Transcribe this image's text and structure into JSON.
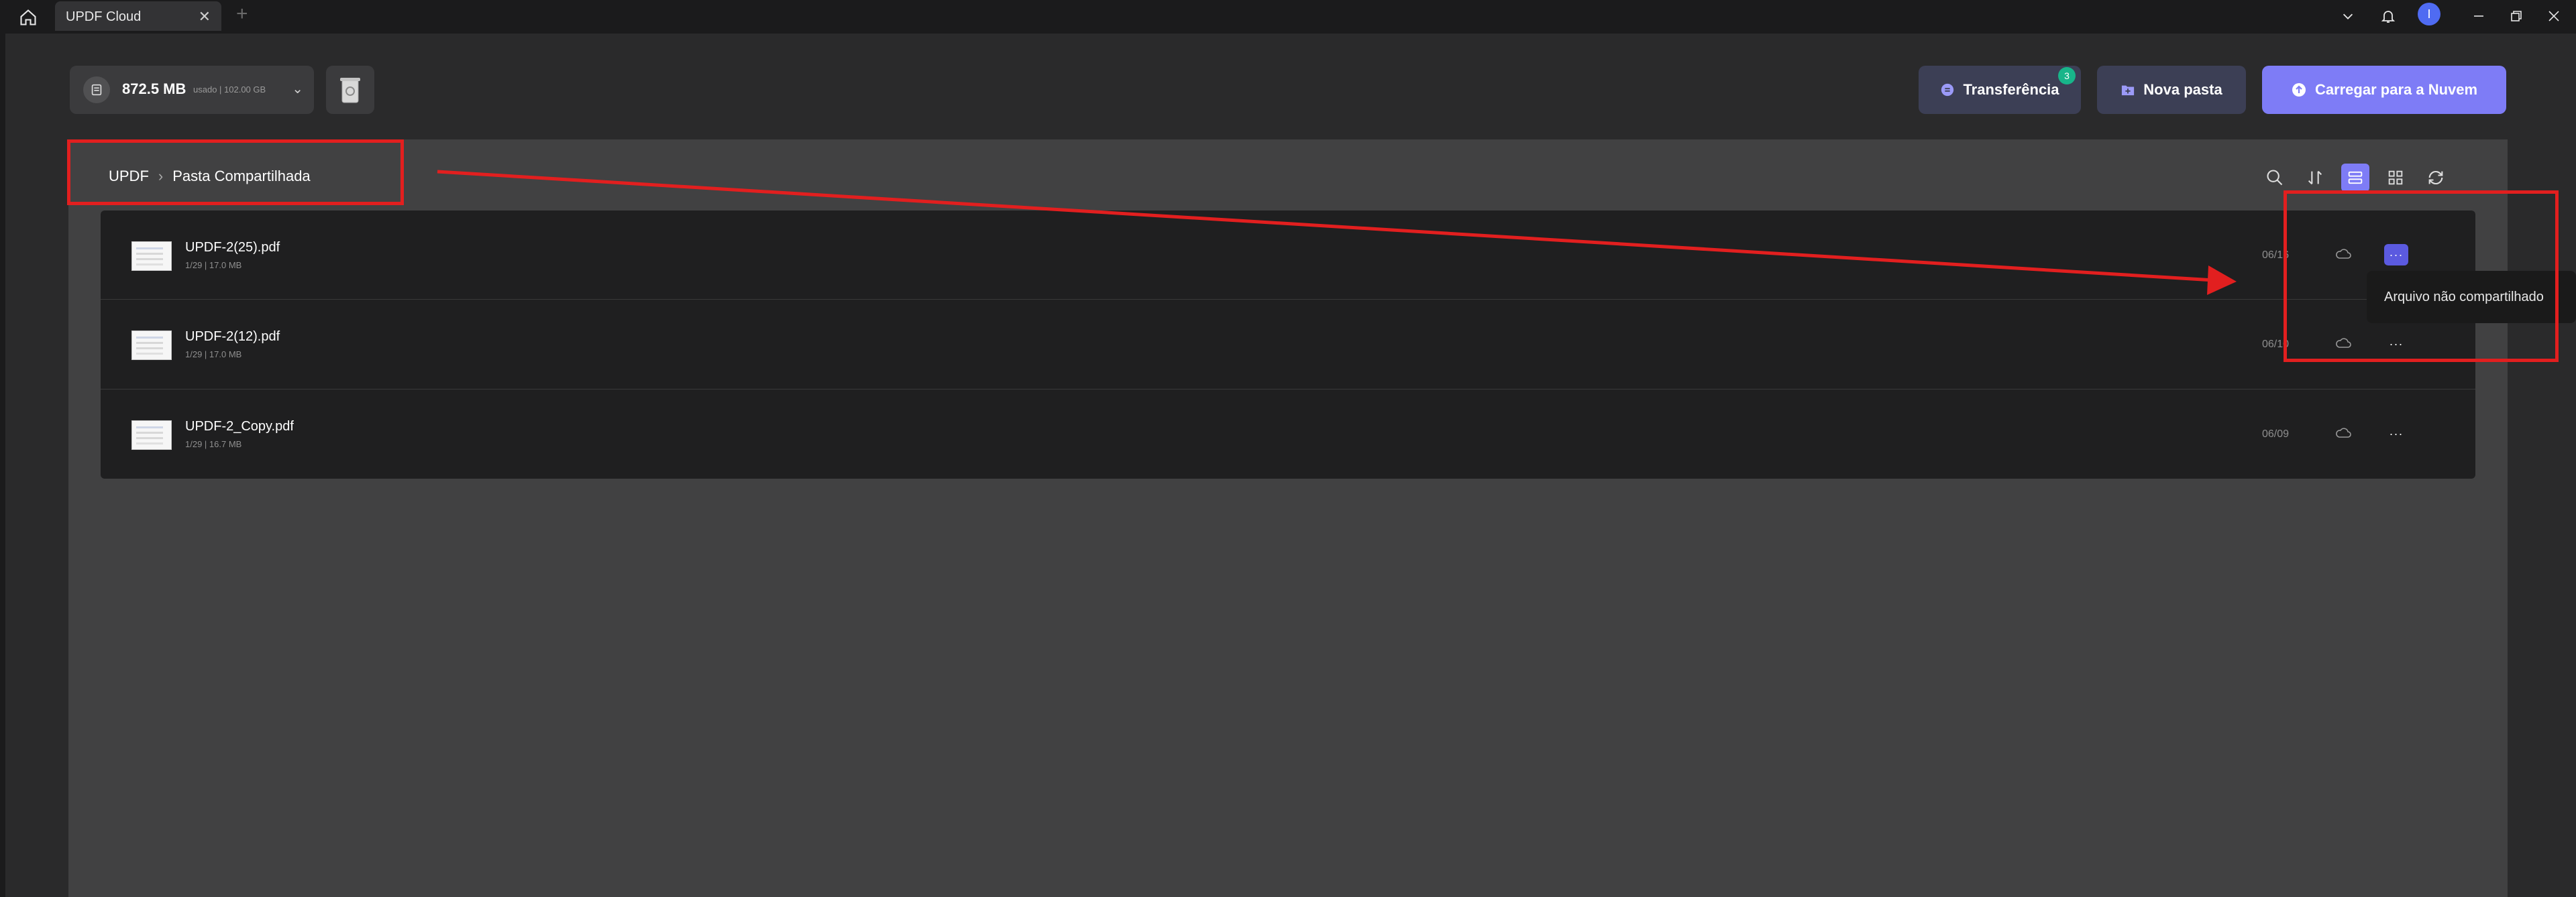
{
  "titlebar": {
    "tab_title": "UPDF Cloud",
    "tab_close": "✕",
    "tab_add": "+",
    "avatar_initial": "I",
    "icons": [
      "home-icon",
      "chevron-down-icon",
      "bell-icon",
      "minimize-icon",
      "restore-icon",
      "close-icon"
    ]
  },
  "storage": {
    "used": "872.5 MB",
    "detail": "usado | 102.00 GB"
  },
  "toolbar": {
    "transfer_label": "Transferência",
    "transfer_badge": "3",
    "new_folder_label": "Nova pasta",
    "upload_label": "Carregar para a Nuvem"
  },
  "breadcrumb": {
    "root": "UPDF",
    "current": "Pasta Compartilhada"
  },
  "files": [
    {
      "name": "UPDF-2(25).pdf",
      "meta": "1/29 | 17.0 MB",
      "date": "06/16"
    },
    {
      "name": "UPDF-2(12).pdf",
      "meta": "1/29 | 17.0 MB",
      "date": "06/10"
    },
    {
      "name": "UPDF-2_Copy.pdf",
      "meta": "1/29 | 16.7 MB",
      "date": "06/09"
    }
  ],
  "more_label": "···",
  "tooltip": "Arquivo não compartilhado",
  "colors": {
    "accent": "#7e7cf6",
    "annotation": "#e21f1f",
    "badge": "#18b58a"
  }
}
